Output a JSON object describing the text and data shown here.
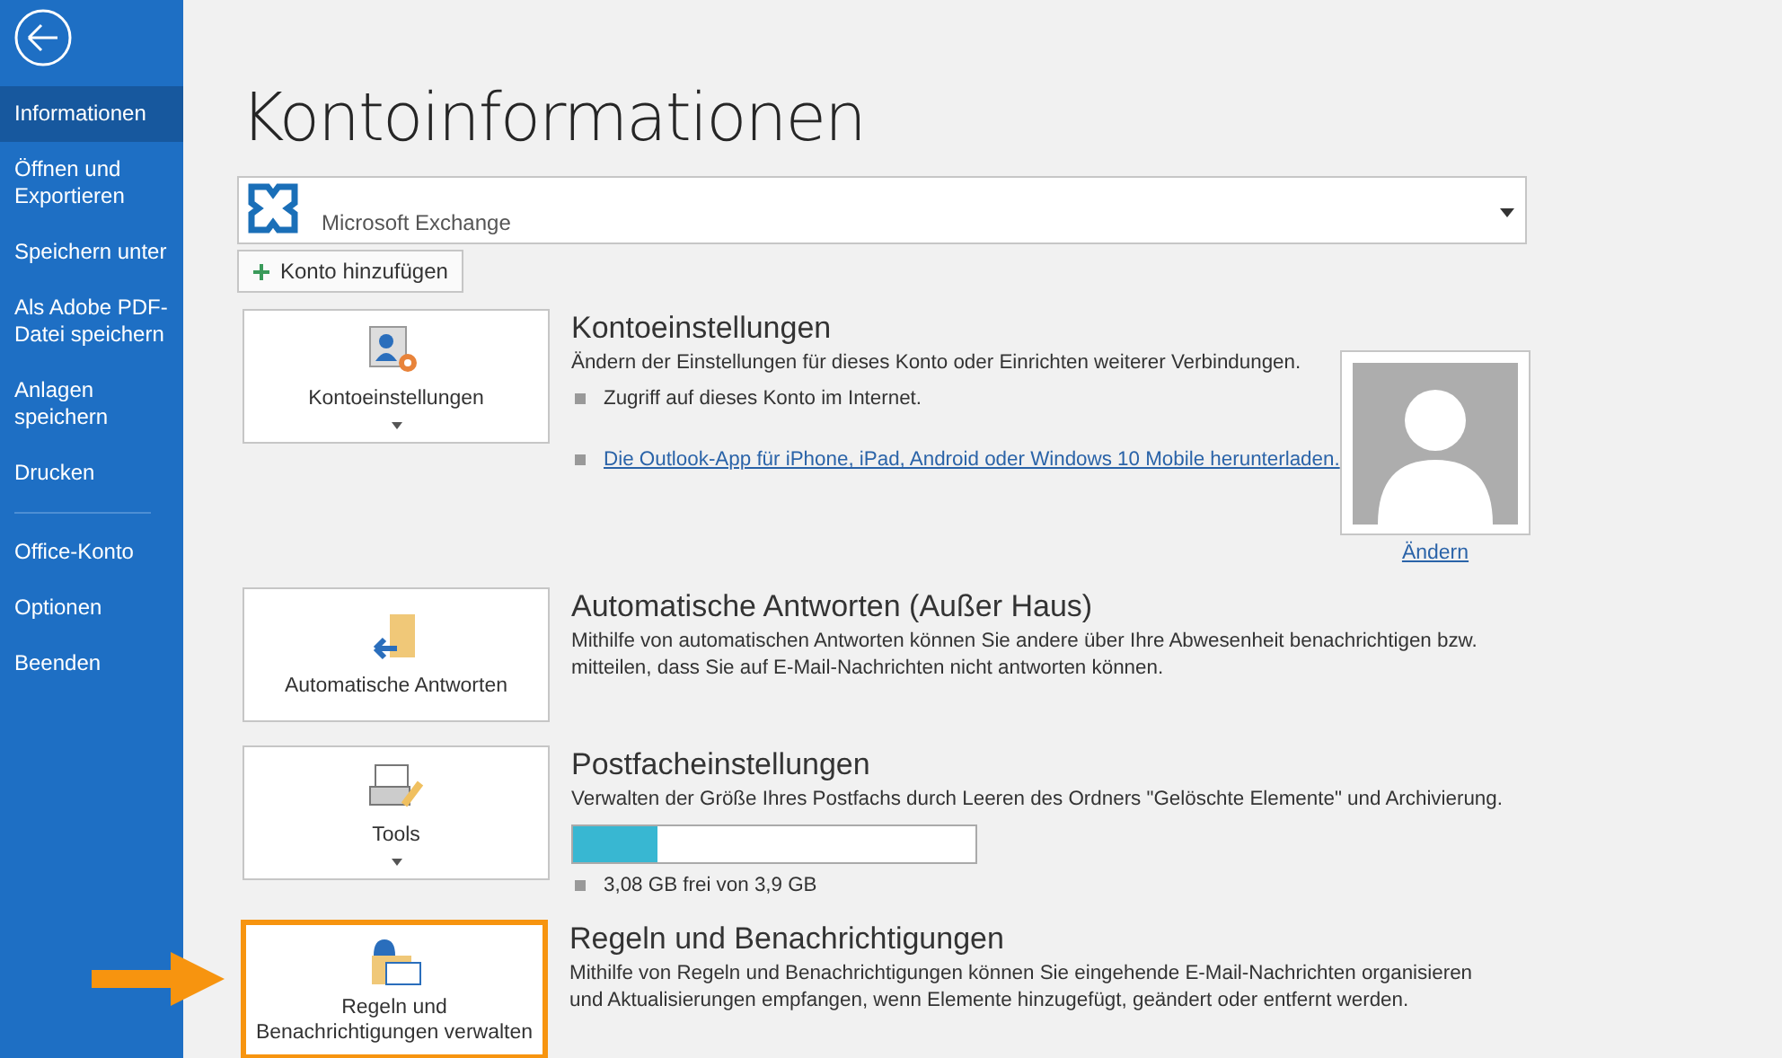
{
  "sidebar": {
    "groups": [
      [
        {
          "label": "Informationen",
          "selected": true
        },
        {
          "label": "Öffnen und Exportieren",
          "selected": false
        },
        {
          "label": "Speichern unter",
          "selected": false
        },
        {
          "label": "Als Adobe PDF-Datei speichern",
          "selected": false
        },
        {
          "label": "Anlagen speichern",
          "selected": false
        },
        {
          "label": "Drucken",
          "selected": false
        }
      ],
      [
        {
          "label": "Office-Konto",
          "selected": false
        },
        {
          "label": "Optionen",
          "selected": false
        },
        {
          "label": "Beenden",
          "selected": false
        }
      ]
    ]
  },
  "page_title": "Kontoinformationen",
  "account_select": {
    "value": "Microsoft Exchange"
  },
  "add_account_button": "Konto hinzufügen",
  "sections": [
    {
      "kind": "account",
      "tile": {
        "label": "Kontoeinstellungen",
        "dropdown": true,
        "highlighted": false
      },
      "heading": "Kontoeinstellungen",
      "description": "Ändern der Einstellungen für dieses Konto oder Einrichten weiterer Verbindungen.",
      "bullets": [
        {
          "text": "Zugriff auf dieses Konto im Internet.",
          "link": false
        },
        {
          "text": "Die Outlook-App für iPhone, iPad, Android oder Windows 10 Mobile herunterladen.",
          "link": true
        }
      ],
      "avatar_link": "Ändern"
    },
    {
      "kind": "autoreply",
      "tile": {
        "label": "Automatische Antworten",
        "dropdown": false,
        "highlighted": false
      },
      "heading": "Automatische Antworten (Außer Haus)",
      "description": "Mithilfe von automatischen Antworten können Sie andere über Ihre Abwesenheit benachrichtigen bzw. mitteilen, dass Sie auf E-Mail-Nachrichten nicht antworten können."
    },
    {
      "kind": "mailbox",
      "tile": {
        "label": "Tools",
        "dropdown": true,
        "highlighted": false
      },
      "heading": "Postfacheinstellungen",
      "description": "Verwalten der Größe Ihres Postfachs durch Leeren des Ordners \"Gelöschte Elemente\" und Archivierung.",
      "storage": {
        "level": 0.21,
        "reading": "3,08 GB frei von 3,9 GB"
      }
    },
    {
      "kind": "rules",
      "tile": {
        "label": "Regeln und Benachrichtigungen verwalten",
        "dropdown": false,
        "highlighted": true
      },
      "heading": "Regeln und Benachrichtigungen",
      "description": "Mithilfe von Regeln und Benachrichtigungen können Sie eingehende E-Mail-Nachrichten organisieren und Aktualisierungen empfangen, wenn Elemente hinzugefügt, geändert oder entfernt werden."
    }
  ]
}
